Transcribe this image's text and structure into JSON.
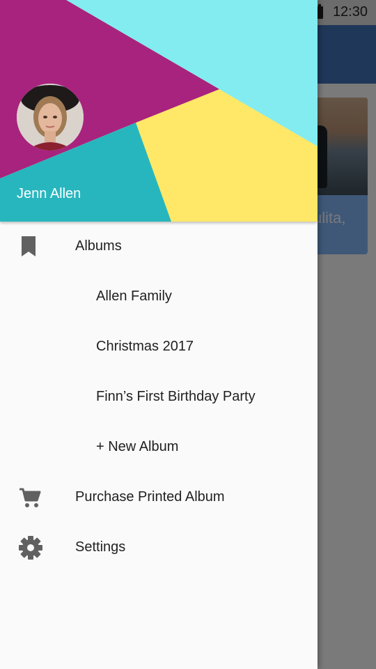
{
  "status_bar": {
    "time": "12:30"
  },
  "background": {
    "card_text": "ulita,"
  },
  "drawer": {
    "header": {
      "user_name": "Jenn Allen"
    },
    "menu": {
      "albums": {
        "label": "Albums",
        "icon": "bookmark-icon"
      },
      "albums_children": [
        {
          "label": "Allen Family"
        },
        {
          "label": "Christmas 2017"
        },
        {
          "label": "Finn’s First Birthday Party"
        },
        {
          "label": "+ New Album"
        }
      ],
      "purchase": {
        "label": "Purchase Printed Album",
        "icon": "cart-icon"
      },
      "settings": {
        "label": "Settings",
        "icon": "gear-icon"
      }
    }
  },
  "colors": {
    "header_magenta": "#a8237e",
    "header_cyan": "#83ecf1",
    "header_yellow": "#ffe867",
    "header_teal": "#28b6be",
    "drawer_background": "#fafafa",
    "icon_gray": "#616161"
  }
}
